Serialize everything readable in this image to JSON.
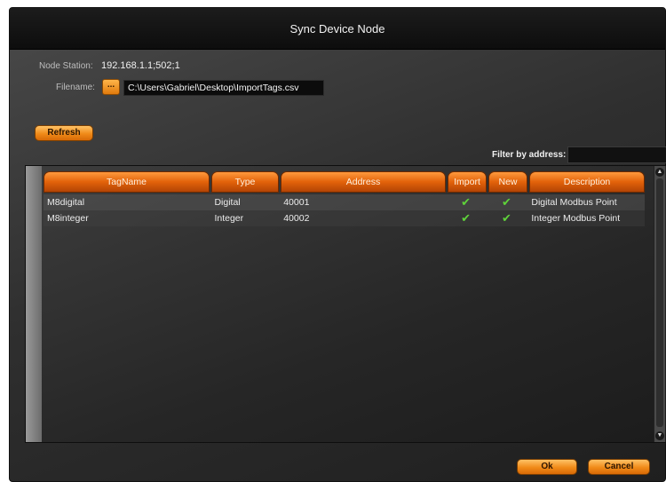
{
  "window": {
    "title": "Sync Device Node"
  },
  "node_station": {
    "label": "Node Station:",
    "value": "192.168.1.1;502;1"
  },
  "filename": {
    "label": "Filename:",
    "browse_label": "...",
    "value": "C:\\Users\\Gabriel\\Desktop\\ImportTags.csv"
  },
  "toolbar": {
    "refresh_label": "Refresh"
  },
  "filter": {
    "label": "Filter by address:",
    "value": ""
  },
  "table": {
    "columns": [
      "TagName",
      "Type",
      "Address",
      "Import",
      "New",
      "Description"
    ],
    "rows": [
      {
        "tagname": "M8digital",
        "type": "Digital",
        "address": "40001",
        "import": "✔",
        "new": "✔",
        "description": "Digital Modbus Point"
      },
      {
        "tagname": "M8integer",
        "type": "Integer",
        "address": "40002",
        "import": "✔",
        "new": "✔",
        "description": "Integer Modbus Point"
      }
    ]
  },
  "footer": {
    "ok_label": "Ok",
    "cancel_label": "Cancel"
  },
  "colors": {
    "accent": "#f08a18",
    "check": "#5fd33a",
    "titlebar": "#111111"
  }
}
